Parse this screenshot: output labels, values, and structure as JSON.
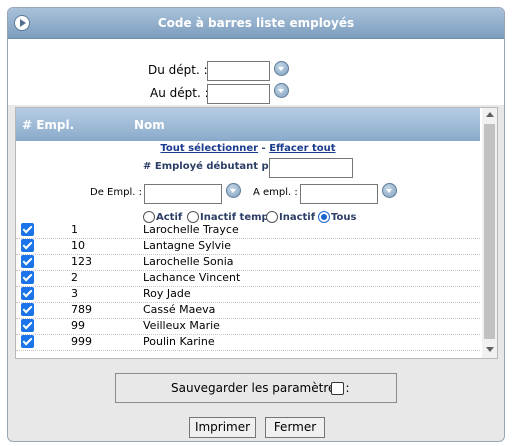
{
  "dialog": {
    "title": "Code à barres liste employés"
  },
  "range": {
    "from_dept_label": "Du dépt. :",
    "from_dept_value": "",
    "to_dept_label": "Au dépt. :",
    "to_dept_value": ""
  },
  "list": {
    "columns": [
      "# Empl.",
      "Nom"
    ],
    "select_all": "Tout sélectionner",
    "separator": " - ",
    "clear_all": "Effacer tout",
    "starting_label": "# Employé débutant par :",
    "starting_value": "",
    "from_emp_label": "De Empl. :",
    "from_emp_value": "",
    "to_emp_label": "A empl. :",
    "to_emp_value": "",
    "status_options": [
      "Actif",
      "Inactif temp.",
      "Inactif",
      "Tous"
    ],
    "status_selected": "Tous",
    "rows": [
      {
        "id": "1",
        "name": "Larochelle Trayce",
        "checked": true
      },
      {
        "id": "10",
        "name": "Lantagne Sylvie",
        "checked": true
      },
      {
        "id": "123",
        "name": "Larochelle Sonia",
        "checked": true
      },
      {
        "id": "2",
        "name": "Lachance Vincent",
        "checked": true
      },
      {
        "id": "3",
        "name": "Roy Jade",
        "checked": true
      },
      {
        "id": "789",
        "name": "Cassé Maeva",
        "checked": true
      },
      {
        "id": "99",
        "name": "Veilleux Marie",
        "checked": true
      },
      {
        "id": "999",
        "name": "Poulin Karine",
        "checked": true
      }
    ]
  },
  "footer": {
    "save_label": "Sauvegarder les paramètres :",
    "save_checked": false,
    "print_label": "Imprimer",
    "close_label": "Fermer"
  },
  "colors": {
    "title_bar": "#8aaacb",
    "checkbox": "#1a73e8",
    "link": "#1a3c8c"
  }
}
